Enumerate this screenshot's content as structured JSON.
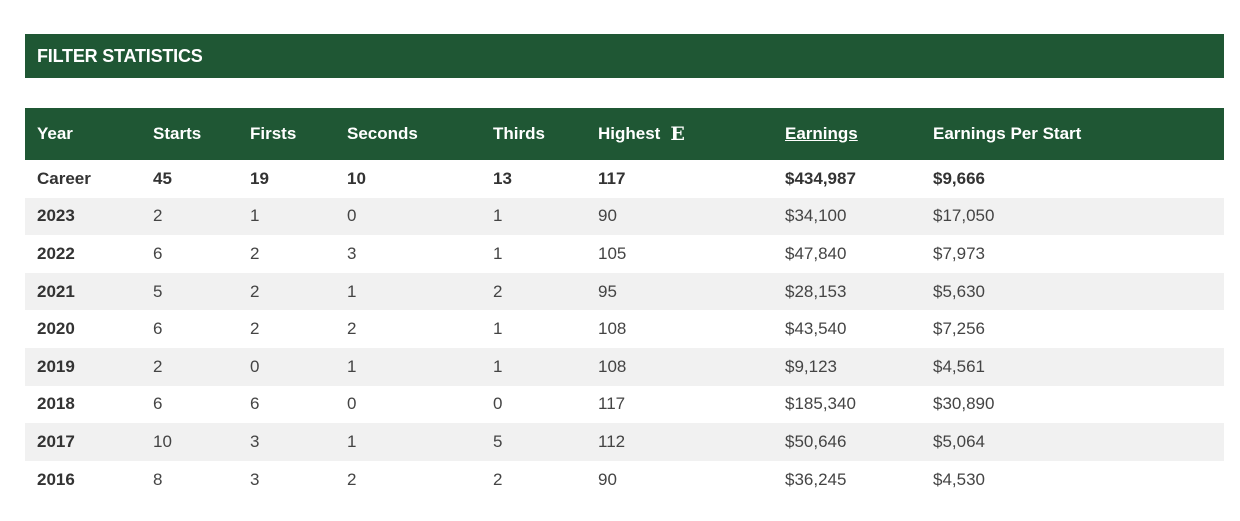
{
  "filter": {
    "title": "FILTER STATISTICS"
  },
  "colors": {
    "header_green": "#1f5734",
    "row_stripe": "#f1f1f1"
  },
  "table": {
    "headers": {
      "year": "Year",
      "starts": "Starts",
      "firsts": "Firsts",
      "seconds": "Seconds",
      "thirds": "Thirds",
      "highest": "Highest",
      "highest_icon": "E",
      "earnings": "Earnings",
      "earnings_per_start": "Earnings Per Start"
    },
    "career": {
      "year": "Career",
      "starts": "45",
      "firsts": "19",
      "seconds": "10",
      "thirds": "13",
      "highest": "117",
      "earnings": "$434,987",
      "earnings_per_start": "$9,666"
    },
    "rows": [
      {
        "year": "2023",
        "starts": "2",
        "firsts": "1",
        "seconds": "0",
        "thirds": "1",
        "highest": "90",
        "earnings": "$34,100",
        "earnings_per_start": "$17,050"
      },
      {
        "year": "2022",
        "starts": "6",
        "firsts": "2",
        "seconds": "3",
        "thirds": "1",
        "highest": "105",
        "earnings": "$47,840",
        "earnings_per_start": "$7,973"
      },
      {
        "year": "2021",
        "starts": "5",
        "firsts": "2",
        "seconds": "1",
        "thirds": "2",
        "highest": "95",
        "earnings": "$28,153",
        "earnings_per_start": "$5,630"
      },
      {
        "year": "2020",
        "starts": "6",
        "firsts": "2",
        "seconds": "2",
        "thirds": "1",
        "highest": "108",
        "earnings": "$43,540",
        "earnings_per_start": "$7,256"
      },
      {
        "year": "2019",
        "starts": "2",
        "firsts": "0",
        "seconds": "1",
        "thirds": "1",
        "highest": "108",
        "earnings": "$9,123",
        "earnings_per_start": "$4,561"
      },
      {
        "year": "2018",
        "starts": "6",
        "firsts": "6",
        "seconds": "0",
        "thirds": "0",
        "highest": "117",
        "earnings": "$185,340",
        "earnings_per_start": "$30,890"
      },
      {
        "year": "2017",
        "starts": "10",
        "firsts": "3",
        "seconds": "1",
        "thirds": "5",
        "highest": "112",
        "earnings": "$50,646",
        "earnings_per_start": "$5,064"
      },
      {
        "year": "2016",
        "starts": "8",
        "firsts": "3",
        "seconds": "2",
        "thirds": "2",
        "highest": "90",
        "earnings": "$36,245",
        "earnings_per_start": "$4,530"
      }
    ]
  }
}
